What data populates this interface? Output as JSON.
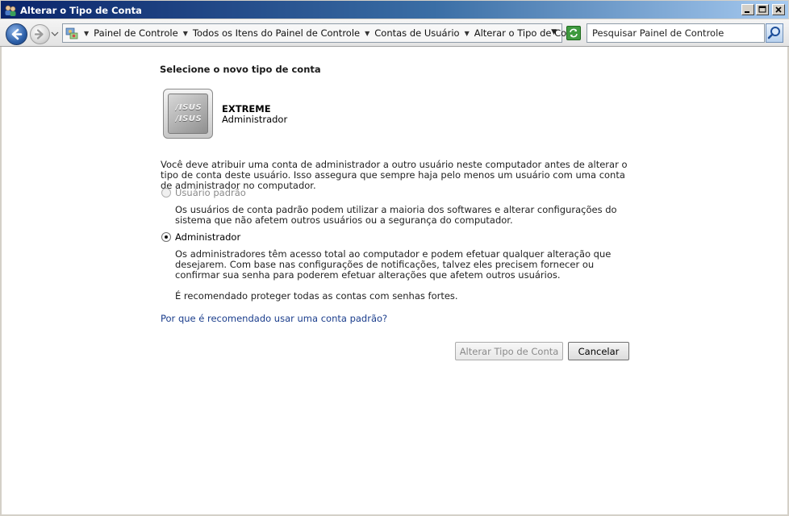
{
  "window": {
    "title": "Alterar o Tipo de Conta",
    "controls": [
      "minimize",
      "maximize",
      "close"
    ]
  },
  "address_bar": {
    "breadcrumbs": [
      "Painel de Controle",
      "Todos os Itens do Painel de Controle",
      "Contas de Usuário",
      "Alterar o Tipo de Conta"
    ],
    "search_placeholder": "Pesquisar Painel de Controle"
  },
  "main": {
    "heading": "Selecione o novo tipo de conta",
    "account": {
      "tile_logo_line1": "/ISUS",
      "tile_logo_line2": "/ISUS",
      "name": "EXTREME",
      "type": "Administrador"
    },
    "info_text": "Você deve atribuir uma conta de administrador a outro usuário neste computador antes de alterar o tipo de conta deste usuário. Isso assegura que sempre haja pelo menos um usuário com uma conta de administrador no computador.",
    "options": [
      {
        "label": "Usuário padrão",
        "selected": false,
        "enabled": false,
        "description": "Os usuários de conta padrão podem utilizar a maioria dos softwares e alterar configurações do sistema que não afetem outros usuários ou a segurança do computador."
      },
      {
        "label": "Administrador",
        "selected": true,
        "enabled": true,
        "description": "Os administradores têm acesso total ao computador e podem efetuar qualquer alteração que desejarem. Com base nas configurações de notificações, talvez eles precisem fornecer ou confirmar sua senha para poderem efetuar alterações que afetem outros usuários.",
        "note": "É recomendado proteger todas as contas com senhas fortes."
      }
    ],
    "help_link": "Por que é recomendado usar uma conta padrão?",
    "buttons": {
      "change": "Alterar Tipo de Conta",
      "cancel": "Cancelar"
    }
  },
  "colors": {
    "title_bar_start": "#0a246a",
    "title_bar_end": "#a6caf0",
    "link": "#1a3d8c",
    "disabled_text": "#8a8a8a"
  }
}
